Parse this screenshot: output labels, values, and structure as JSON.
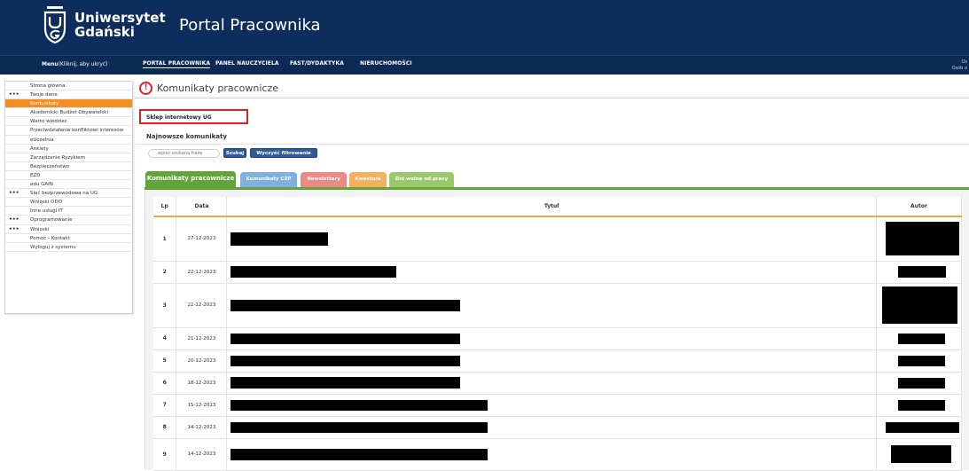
{
  "header": {
    "university_name_line1": "Uniwersytet",
    "university_name_line2": "Gdański",
    "portal_title": "Portal Pracownika"
  },
  "navbar": {
    "menu_toggle_bold": "Menu",
    "menu_toggle_rest": "(Kliknij, aby ukryć)",
    "items": [
      "PORTAL PRACOWNIKA",
      "PANEL NAUCZYCIELA",
      "FAST/DYDAKTYKA",
      "NIERUCHOMOŚCI"
    ],
    "right_text_line1": "Os",
    "right_text_line2": "Osób o"
  },
  "sidebar": {
    "items": [
      {
        "label": "Strona główna",
        "dots": ""
      },
      {
        "label": "Twoje dane",
        "dots": "•••"
      },
      {
        "label": "Komunikaty",
        "dots": ""
      },
      {
        "label": "Akademicki Budżet Obywatelski",
        "dots": ""
      },
      {
        "label": "Warto wiedzieć",
        "dots": ""
      },
      {
        "label": "Przeciwdziałanie konfliktowi interesów",
        "dots": ""
      },
      {
        "label": "eUczelnia",
        "dots": ""
      },
      {
        "label": "Ankiety",
        "dots": ""
      },
      {
        "label": "Zarządzanie Ryzykiem",
        "dots": ""
      },
      {
        "label": "Bezpieczeństwo",
        "dots": ""
      },
      {
        "label": "EZD",
        "dots": ""
      },
      {
        "label": "edu GAIN",
        "dots": ""
      },
      {
        "label": "Sieć bezprzewodowa na UG",
        "dots": "•••"
      },
      {
        "label": "Wnioski ODO",
        "dots": ""
      },
      {
        "label": "Inne usługi IT",
        "dots": ""
      },
      {
        "label": "Oprogramowanie",
        "dots": "•••"
      },
      {
        "label": "Wnioski",
        "dots": "•••"
      },
      {
        "label": "Pomoc - Kontakt",
        "dots": ""
      },
      {
        "label": "Wyloguj z systemu",
        "dots": ""
      }
    ]
  },
  "main": {
    "alert_glyph": "!",
    "page_title": "Komunikaty pracownicze",
    "shop_link": "Sklep internetowy UG",
    "latest_heading": "Najnowsze komunikaty",
    "search_placeholder": "wpisz szukaną frazę",
    "search_button": "Szukaj",
    "clear_button": "Wyczyść filtrowanie",
    "tabs": [
      {
        "label": "Komunikaty pracownicze",
        "color": "#62a33a"
      },
      {
        "label": "Komunikaty CZP",
        "color": "#7fb0de"
      },
      {
        "label": "Newslettery",
        "color": "#ee8a86"
      },
      {
        "label": "Kwestura",
        "color": "#f5b05e"
      },
      {
        "label": "Dni wolne od pracy",
        "color": "#9bc96a"
      }
    ],
    "table": {
      "headers": [
        "Lp",
        "Data",
        "Tytuł",
        "Autor"
      ],
      "rows": [
        {
          "lp": "1",
          "date": "27-12-2023"
        },
        {
          "lp": "2",
          "date": "22-12-2023"
        },
        {
          "lp": "3",
          "date": "22-12-2023"
        },
        {
          "lp": "4",
          "date": "21-12-2023"
        },
        {
          "lp": "5",
          "date": "20-12-2023"
        },
        {
          "lp": "6",
          "date": "18-12-2023"
        },
        {
          "lp": "7",
          "date": "15-12-2023"
        },
        {
          "lp": "8",
          "date": "14-12-2023"
        },
        {
          "lp": "9",
          "date": "14-12-2023"
        }
      ]
    }
  }
}
